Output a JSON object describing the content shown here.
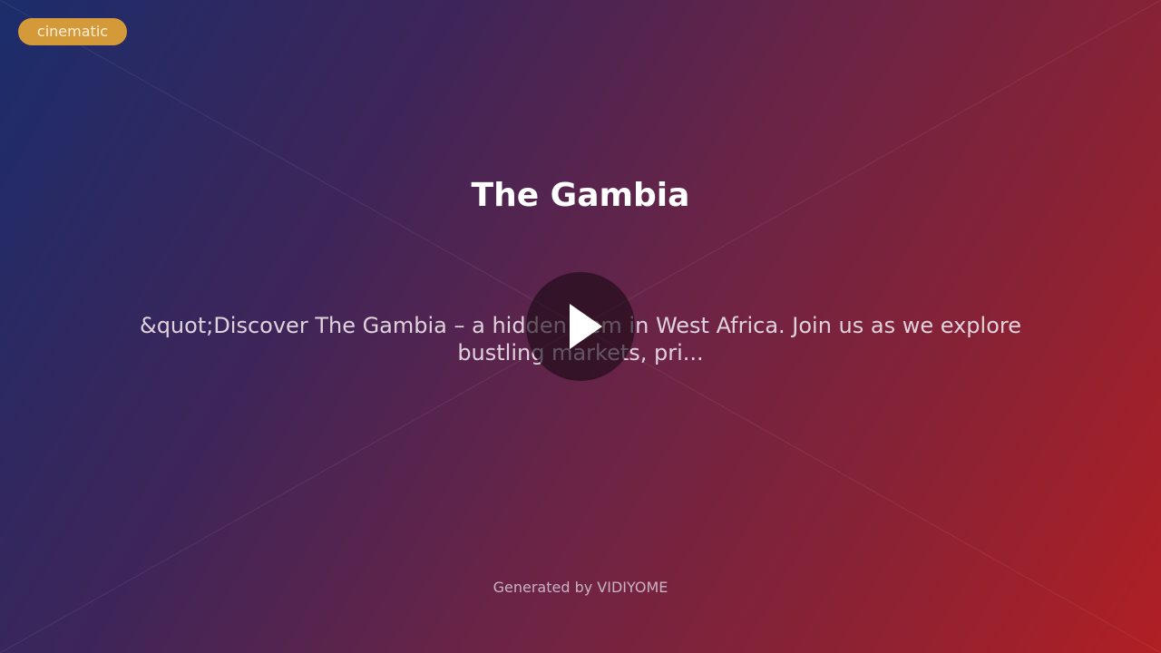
{
  "badge": {
    "label": "cinematic",
    "color": "#d49a3a"
  },
  "video": {
    "title": "The Gambia",
    "description": "&quot;Discover The Gambia – a hidden gem in West Africa. Join us as we explore bustling markets, pri...",
    "play_icon": "play-icon"
  },
  "footer": {
    "credit": "Generated by VIDIYOME"
  },
  "colors": {
    "gradient_start": "#1b2d6b",
    "gradient_end": "#b01f24",
    "title": "#ffffff",
    "text": "#e0d2dc"
  }
}
